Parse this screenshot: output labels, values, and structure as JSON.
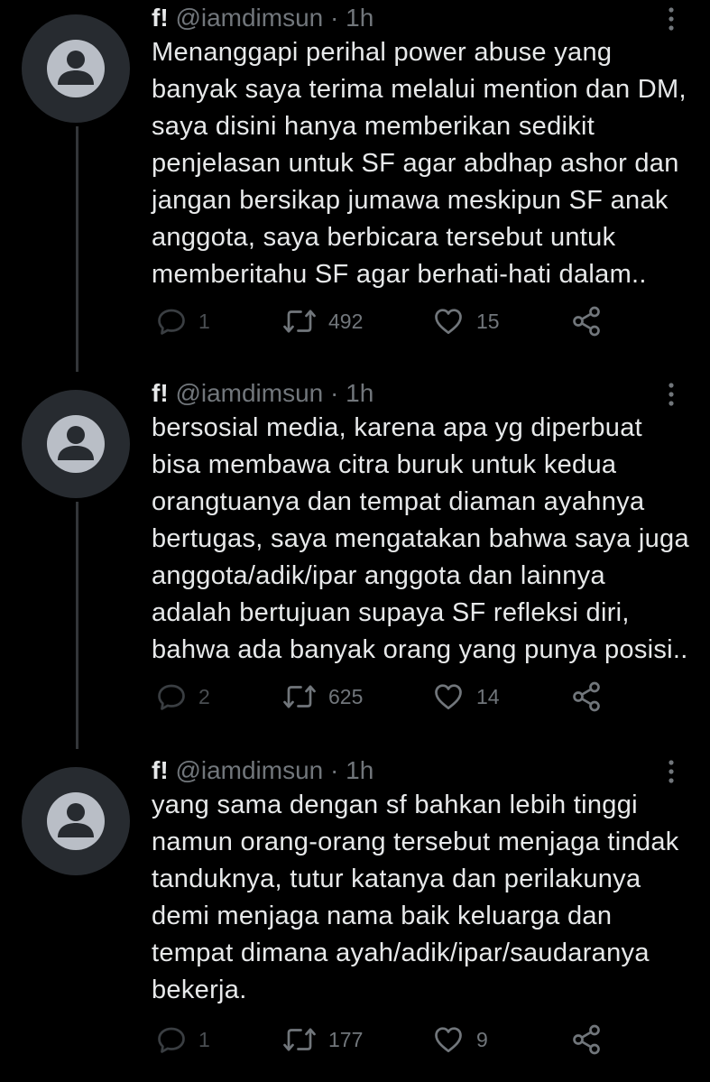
{
  "colors": {
    "background": "#000000",
    "text": "#e7e9ea",
    "muted": "#71767b",
    "thread_line": "#333639",
    "avatar_bg": "#272b30",
    "avatar_fg": "#b9bec6"
  },
  "icons": {
    "reply": "reply-icon",
    "retweet": "retweet-icon",
    "like": "heart-icon",
    "share": "share-icon",
    "more": "more-vertical-icon",
    "avatar": "default-avatar-icon"
  },
  "tweets": [
    {
      "name": "f!",
      "handle": "@iamdimsun",
      "separator": "·",
      "time": "1h",
      "lines": [
        "Menanggapi perihal power abuse yang",
        "banyak saya terima melalui mention dan DM,",
        "saya disini hanya memberikan sedikit",
        "penjelasan untuk SF agar abdhap ashor dan",
        "jangan bersikap jumawa meskipun SF anak",
        "anggota, saya berbicara tersebut untuk",
        "memberitahu SF agar berhati-hati dalam.."
      ],
      "replies": "1",
      "retweets": "492",
      "likes": "15"
    },
    {
      "name": "f!",
      "handle": "@iamdimsun",
      "separator": "·",
      "time": "1h",
      "lines": [
        "bersosial media, karena apa yg diperbuat",
        "bisa membawa citra buruk untuk kedua",
        "orangtuanya dan tempat diaman ayahnya",
        "bertugas, saya mengatakan bahwa saya juga",
        "anggota/adik/ipar anggota dan lainnya",
        "adalah bertujuan supaya SF refleksi diri,",
        "bahwa ada banyak orang yang punya posisi.."
      ],
      "replies": "2",
      "retweets": "625",
      "likes": "14"
    },
    {
      "name": "f!",
      "handle": "@iamdimsun",
      "separator": "·",
      "time": "1h",
      "lines": [
        "yang sama dengan sf bahkan lebih tinggi",
        "namun orang-orang tersebut menjaga tindak",
        "tanduknya, tutur katanya dan perilakunya",
        "demi menjaga nama baik keluarga dan",
        "tempat dimana ayah/adik/ipar/saudaranya",
        "bekerja."
      ],
      "replies": "1",
      "retweets": "177",
      "likes": "9"
    }
  ]
}
